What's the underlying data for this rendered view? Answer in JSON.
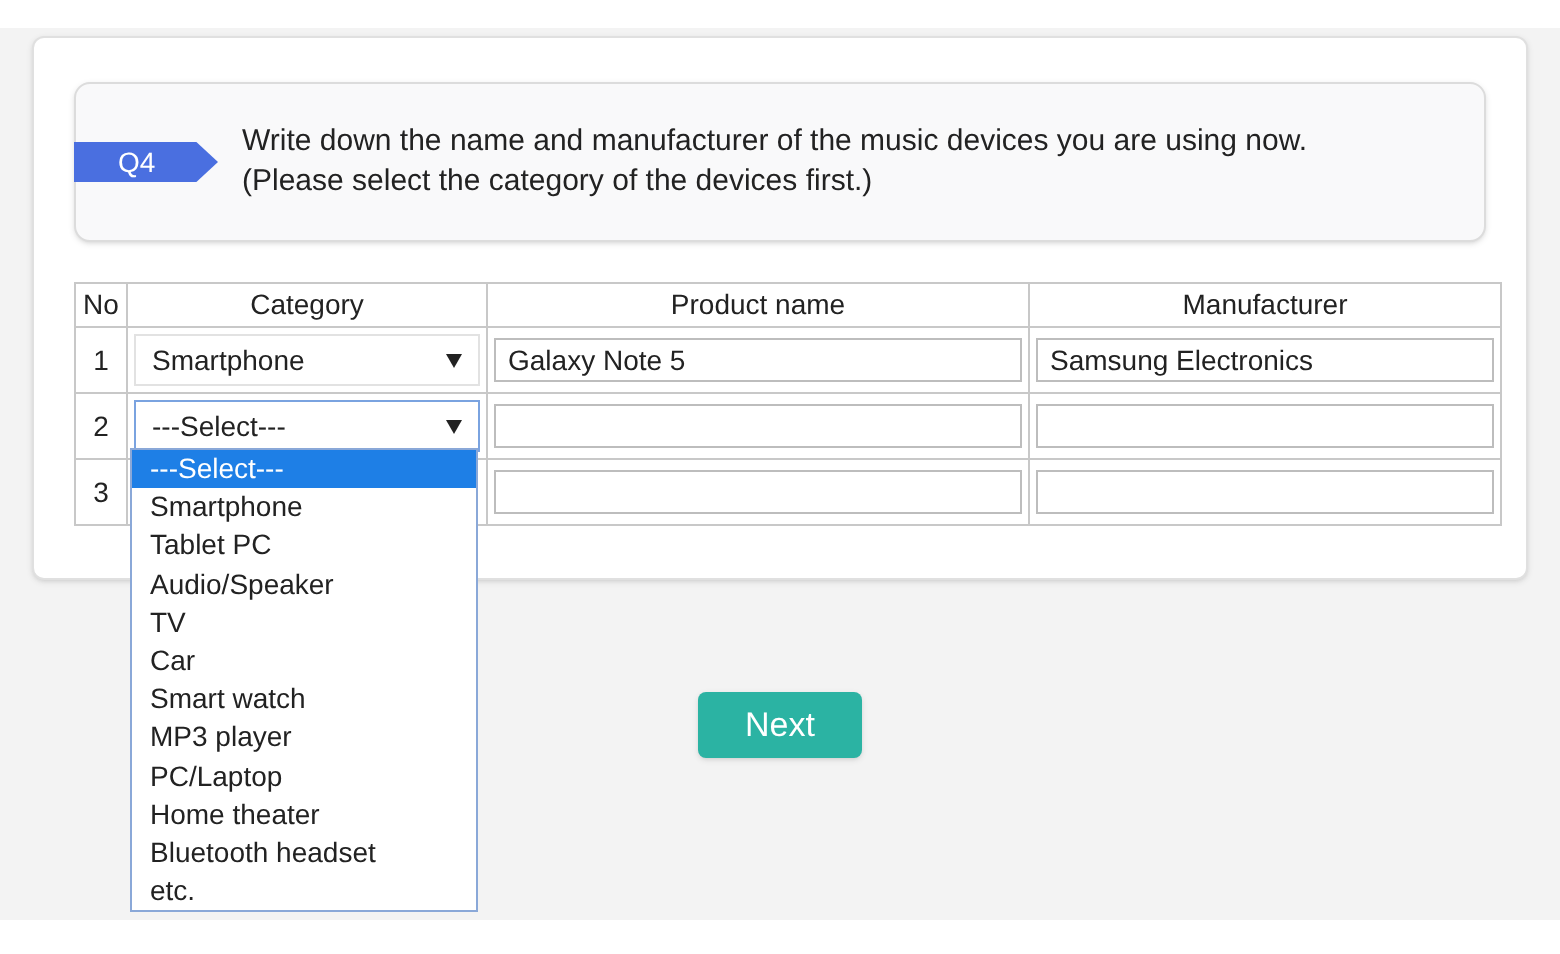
{
  "question": {
    "badge": "Q4",
    "lines": [
      "Write down the name and manufacturer of the music devices you are using now.",
      "(Please select the category of the devices first.)"
    ]
  },
  "table": {
    "columns": [
      "No",
      "Category",
      "Product name",
      "Manufacturer"
    ],
    "rows": [
      {
        "no": "1",
        "category": "Smartphone",
        "product": "Galaxy Note 5",
        "manufacturer": "Samsung Electronics",
        "focused": false
      },
      {
        "no": "2",
        "category": "---Select---",
        "product": "",
        "manufacturer": "",
        "focused": true
      },
      {
        "no": "3",
        "product": "",
        "manufacturer": ""
      }
    ]
  },
  "dropdown": {
    "options": [
      {
        "label": "---Select---",
        "selected": true
      },
      {
        "label": "Smartphone",
        "selected": false
      },
      {
        "label": "Tablet PC",
        "selected": false
      },
      {
        "label": "Audio/Speaker",
        "selected": false
      },
      {
        "label": "TV",
        "selected": false
      },
      {
        "label": "Car",
        "selected": false
      },
      {
        "label": "Smart watch",
        "selected": false
      },
      {
        "label": "MP3 player",
        "selected": false
      },
      {
        "label": "PC/Laptop",
        "selected": false
      },
      {
        "label": "Home theater",
        "selected": false
      },
      {
        "label": "Bluetooth headset",
        "selected": false
      },
      {
        "label": "etc.",
        "selected": false
      }
    ]
  },
  "next_button": "Next"
}
